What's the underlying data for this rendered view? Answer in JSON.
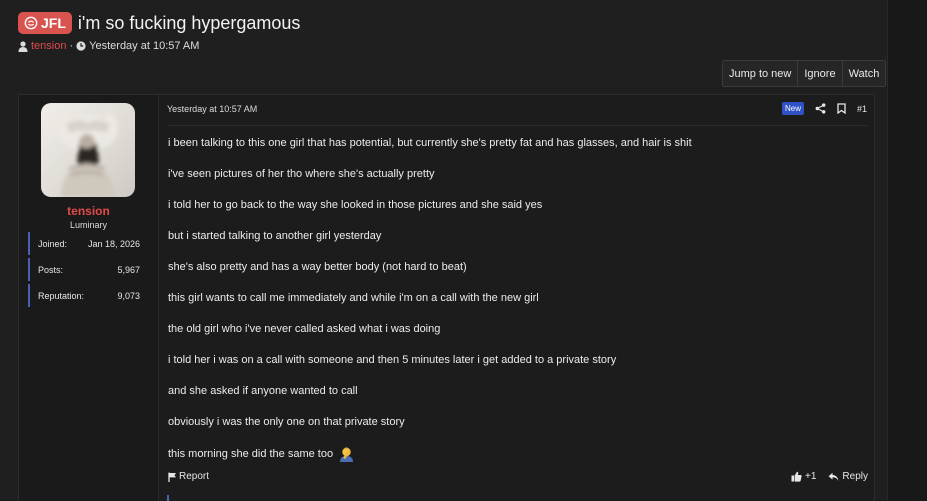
{
  "thread": {
    "prefix": "JFL",
    "title": "i'm so fucking hypergamous",
    "author": "tension",
    "separator": "·",
    "time": "Yesterday at 10:57 AM"
  },
  "actions": {
    "jump_label": "Jump to new",
    "ignore_label": "Ignore",
    "watch_label": "Watch"
  },
  "user": {
    "name": "tension",
    "title": "Luminary",
    "stats": [
      {
        "label": "Joined:",
        "value": "Jan 18, 2026"
      },
      {
        "label": "Posts:",
        "value": "5,967"
      },
      {
        "label": "Reputation:",
        "value": "9,073"
      }
    ]
  },
  "post": {
    "date": "Yesterday at 10:57 AM",
    "new_badge": "New",
    "number": "#1",
    "lines": [
      "i been talking to this one girl that has potential, but currently she's pretty fat and has glasses, and hair is shit",
      "i've seen pictures of her tho where she's actually pretty",
      "i told her to go back to the way she looked in those pictures and she said yes",
      "but i started talking to another girl yesterday",
      "she's also pretty and has a way better body (not hard to beat)",
      "this girl wants to call me immediately and while i'm on a call with the new girl",
      "the old girl who i've never called asked what i was doing",
      "i told her i was on a call with someone and then 5 minutes later i get added to a private story",
      "and she asked if anyone wanted to call",
      "obviously i was the only one on that private story",
      "this morning she did the same too"
    ],
    "emoji_icon": "facepalm-emoji",
    "report_label": "Report",
    "reaction_count": "+1",
    "reply_label": "Reply"
  },
  "colors": {
    "prefix_bg": "#d9534f",
    "username": "#e24a4a",
    "accent_blue": "#2f52c7",
    "stat_border": "#4b5fb0"
  }
}
